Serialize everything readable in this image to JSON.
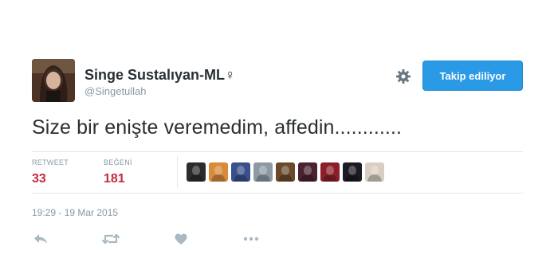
{
  "user": {
    "display_name": "Singe Sustalıyan-ML♀",
    "handle": "@Singetullah"
  },
  "follow_button": {
    "label": "Takip ediliyor"
  },
  "tweet": {
    "text": "Size bir enişte veremedim, affedin............"
  },
  "stats": {
    "retweet_label": "RETWEET",
    "retweet_count": "33",
    "likes_label": "BEĞENİ",
    "likes_count": "181"
  },
  "likers": [
    {
      "icon": "liker-avatar-1",
      "color": "#2c2c2c"
    },
    {
      "icon": "liker-avatar-2",
      "color": "#d98a3a"
    },
    {
      "icon": "liker-avatar-3",
      "color": "#3a4f8c"
    },
    {
      "icon": "liker-avatar-4",
      "color": "#8d9aa3"
    },
    {
      "icon": "liker-avatar-5",
      "color": "#6b4a2b"
    },
    {
      "icon": "liker-avatar-6",
      "color": "#4a2230"
    },
    {
      "icon": "liker-avatar-7",
      "color": "#8a1f2a"
    },
    {
      "icon": "liker-avatar-8",
      "color": "#1c1a22"
    },
    {
      "icon": "liker-avatar-9",
      "color": "#d8cfc2"
    }
  ],
  "timestamp": "19:29 - 19 Mar 2015",
  "colors": {
    "accent": "#2b9ae6",
    "count_red": "#c42b3c",
    "muted": "#8899a6"
  },
  "actions": [
    {
      "icon": "reply-icon"
    },
    {
      "icon": "retweet-icon"
    },
    {
      "icon": "heart-icon"
    },
    {
      "icon": "more-icon"
    }
  ]
}
